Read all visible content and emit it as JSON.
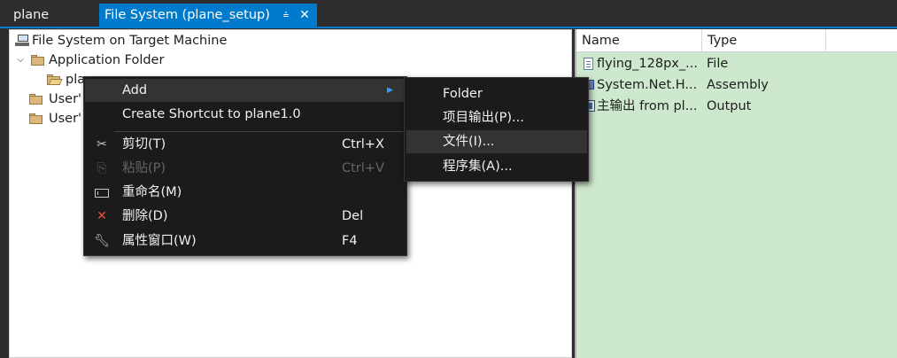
{
  "tabs": {
    "inactive_label": "plane",
    "active_label": "File System (plane_setup)",
    "pin_icon": "pin-icon",
    "close_icon": "close-icon",
    "accent": "#007acc"
  },
  "tree": {
    "root_label": "File System on Target Machine",
    "items": [
      {
        "label": "Application Folder"
      },
      {
        "label": "pla"
      },
      {
        "label": "User'"
      },
      {
        "label": "User'"
      }
    ]
  },
  "list": {
    "columns": [
      "Name",
      "Type"
    ],
    "rows": [
      {
        "name": "flying_128px_...",
        "type": "File",
        "icon": "file-icon"
      },
      {
        "name": "System.Net.H...",
        "type": "Assembly",
        "icon": "assembly-icon"
      },
      {
        "name": "主输出 from pl...",
        "type": "Output",
        "icon": "output-icon"
      }
    ],
    "background": "#cde8cc"
  },
  "context_menu": {
    "items": [
      {
        "label": "Add",
        "shortcut": "",
        "submenu": true
      },
      {
        "label": "Create Shortcut to plane1.0",
        "shortcut": ""
      },
      {
        "label": "剪切(T)",
        "shortcut": "Ctrl+X",
        "icon": "scissors-icon"
      },
      {
        "label": "粘贴(P)",
        "shortcut": "Ctrl+V",
        "icon": "paste-icon",
        "disabled": true
      },
      {
        "label": "重命名(M)",
        "shortcut": "",
        "icon": "rename-icon"
      },
      {
        "label": "删除(D)",
        "shortcut": "Del",
        "icon": "delete-icon"
      },
      {
        "label": "属性窗口(W)",
        "shortcut": "F4",
        "icon": "wrench-icon"
      }
    ]
  },
  "submenu": {
    "items": [
      {
        "label": "Folder"
      },
      {
        "label": "项目输出(P)..."
      },
      {
        "label": "文件(I)..."
      },
      {
        "label": "程序集(A)..."
      }
    ]
  }
}
